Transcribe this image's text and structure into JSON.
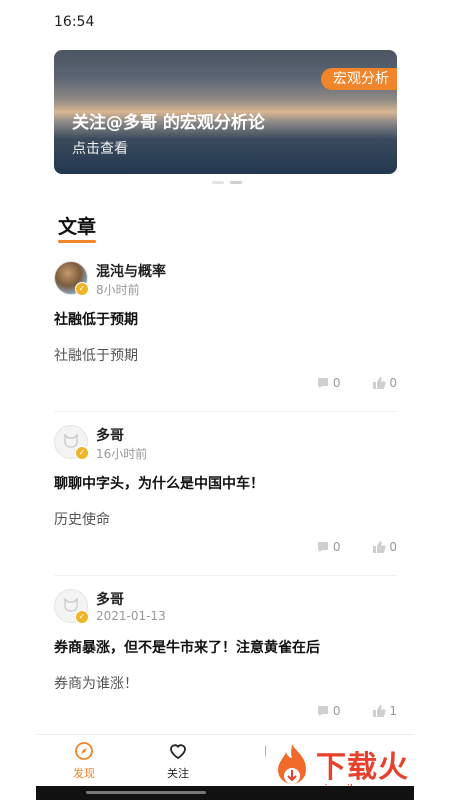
{
  "status_bar": {
    "time": "16:54"
  },
  "banner": {
    "tag": "宏观分析",
    "title": "关注@多哥 的宏观分析论",
    "subtitle": "点击查看"
  },
  "section": {
    "title": "文章"
  },
  "articles": [
    {
      "author": "混沌与概率",
      "time": "8小时前",
      "headline": "社融低于预期",
      "summary": "社融低于预期",
      "comments": "0",
      "likes": "0"
    },
    {
      "author": "多哥",
      "time": "16小时前",
      "headline": "聊聊中字头，为什么是中国中车！",
      "summary": "历史使命",
      "comments": "0",
      "likes": "0"
    },
    {
      "author": "多哥",
      "time": "2021-01-13",
      "headline": "券商暴涨，但不是牛市来了！注意黄雀在后",
      "summary": "券商为谁涨！",
      "comments": "0",
      "likes": "1"
    }
  ],
  "tabbar": {
    "tabs": [
      {
        "label": "发现",
        "icon": "compass-icon",
        "active": true
      },
      {
        "label": "关注",
        "icon": "heart-icon",
        "active": false
      },
      {
        "label": "",
        "icon": "unknown-icon",
        "active": false
      },
      {
        "label": "",
        "icon": "unknown-icon",
        "active": false
      }
    ]
  },
  "watermark": {
    "text": "下载火",
    "domain": "xiazaihuo.com"
  },
  "colors": {
    "accent": "#f0852b",
    "watermark_red": "#e8402a"
  }
}
